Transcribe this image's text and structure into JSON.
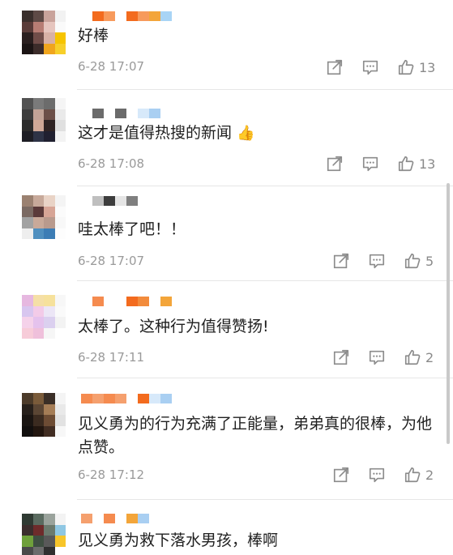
{
  "comments": [
    {
      "text": "好棒",
      "time": "6-28 17:07",
      "likes": "13",
      "avatar_colors": [
        "#3a2f2c",
        "#5e4a46",
        "#c9a39b",
        "#f2f2f2",
        "#5a3c39",
        "#b77d74",
        "#e6c5be",
        "#fafafa",
        "#2a1f1f",
        "#704d49",
        "#d8b1a6",
        "#f6c400",
        "#1b1414",
        "#3c2c2a",
        "#f0a51d",
        "#f7cf2a"
      ],
      "name_colors": [
        "#ffffff",
        "#f36b1e",
        "#f79a5c",
        "#ffffff",
        "#f36b1e",
        "#f79a5c",
        "#f3a53a",
        "#a8d4f5"
      ]
    },
    {
      "text": "这才是值得热搜的新闻",
      "emoji": "👍",
      "time": "6-28 17:08",
      "likes": "13",
      "avatar_colors": [
        "#525252",
        "#7a7a7a",
        "#6c6c6c",
        "#f5f5f5",
        "#3d3d3d",
        "#c2a397",
        "#6c4f48",
        "#eaeaea",
        "#2b2b2b",
        "#cfa897",
        "#2f2424",
        "#e0e0e0",
        "#1d1d24",
        "#2e3346",
        "#202030",
        "#f3f3f3"
      ],
      "name_colors": [
        "#ffffff",
        "#6b6b6b",
        "#ffffff",
        "#6b6b6b",
        "#ffffff",
        "#d7e9fa",
        "#a9cff2",
        "#ffffff"
      ]
    },
    {
      "text": "哇太棒了吧！！",
      "time": "6-28 17:07",
      "likes": "5",
      "avatar_colors": [
        "#9b8171",
        "#c7a99a",
        "#e9d3c6",
        "#f4f4f4",
        "#7b6a63",
        "#5b3a3a",
        "#d7a596",
        "#fbfbfb",
        "#a2a2a2",
        "#c9a999",
        "#b99a8d",
        "#f8f8f8",
        "#eeeeee",
        "#4f8fbf",
        "#3c7db5",
        "#fdfdfd"
      ],
      "name_colors": [
        "#ffffff",
        "#bfbfbf",
        "#3d3d3d",
        "#e5e5e5",
        "#7f7f7f",
        "#ffffff",
        "#ffffff",
        "#ffffff"
      ]
    },
    {
      "text": "太棒了。这种行为值得赞扬!",
      "time": "6-28 17:11",
      "likes": "2",
      "avatar_colors": [
        "#e6b8e0",
        "#f5dfa7",
        "#f6e19c",
        "#f7f7f7",
        "#d8c6ef",
        "#f3cbe8",
        "#ece6f6",
        "#fafafa",
        "#f5d2ea",
        "#e5c2ed",
        "#dbd0ef",
        "#f3f3f3",
        "#f7ccd9",
        "#efc0db",
        "#f6f6f6",
        "#ffffff"
      ],
      "name_colors": [
        "#ffffff",
        "#f58b4f",
        "#ffffff",
        "#ffffff",
        "#f36b1e",
        "#f28b3c",
        "#ffffff",
        "#f3a53a"
      ]
    },
    {
      "text": "见义勇为的行为充满了正能量，弟弟真的很棒，为他点赞。",
      "time": "6-28 17:12",
      "likes": "2",
      "avatar_colors": [
        "#4c3b2a",
        "#7a5b3a",
        "#3a2e26",
        "#f4f4f4",
        "#27201b",
        "#5b4634",
        "#a57d56",
        "#e9e9e9",
        "#1a1512",
        "#3b2b20",
        "#6d4c34",
        "#e2e2e2",
        "#120f0e",
        "#22160f",
        "#412d22",
        "#f7f7f7"
      ],
      "name_colors": [
        "#f58b4f",
        "#f5a06e",
        "#f58b4f",
        "#f5a06e",
        "#ffffff",
        "#f36b1e",
        "#d7e9fa",
        "#a9cff2"
      ]
    },
    {
      "text": "见义勇为救下落水男孩，棒啊",
      "time": "",
      "likes": "",
      "avatar_colors": [
        "#2f3a33",
        "#5a6b60",
        "#9aa39c",
        "#f3f3f3",
        "#3b2d2d",
        "#6e2b2b",
        "#6b7a6e",
        "#8fc7e3",
        "#6fa03b",
        "#3f4f42",
        "#595959",
        "#f7c52a",
        "#4a4a4a",
        "#6c6c6c",
        "#2f2f2f",
        "#ffffff"
      ],
      "name_colors": [
        "#f5a06e",
        "#ffffff",
        "#f58b4f",
        "#ffffff",
        "#f3a53a",
        "#a9cff2",
        "#ffffff",
        "#ffffff"
      ]
    }
  ],
  "icons": {
    "share": "share-icon",
    "comment": "comment-icon",
    "like": "thumbs-up-icon"
  }
}
